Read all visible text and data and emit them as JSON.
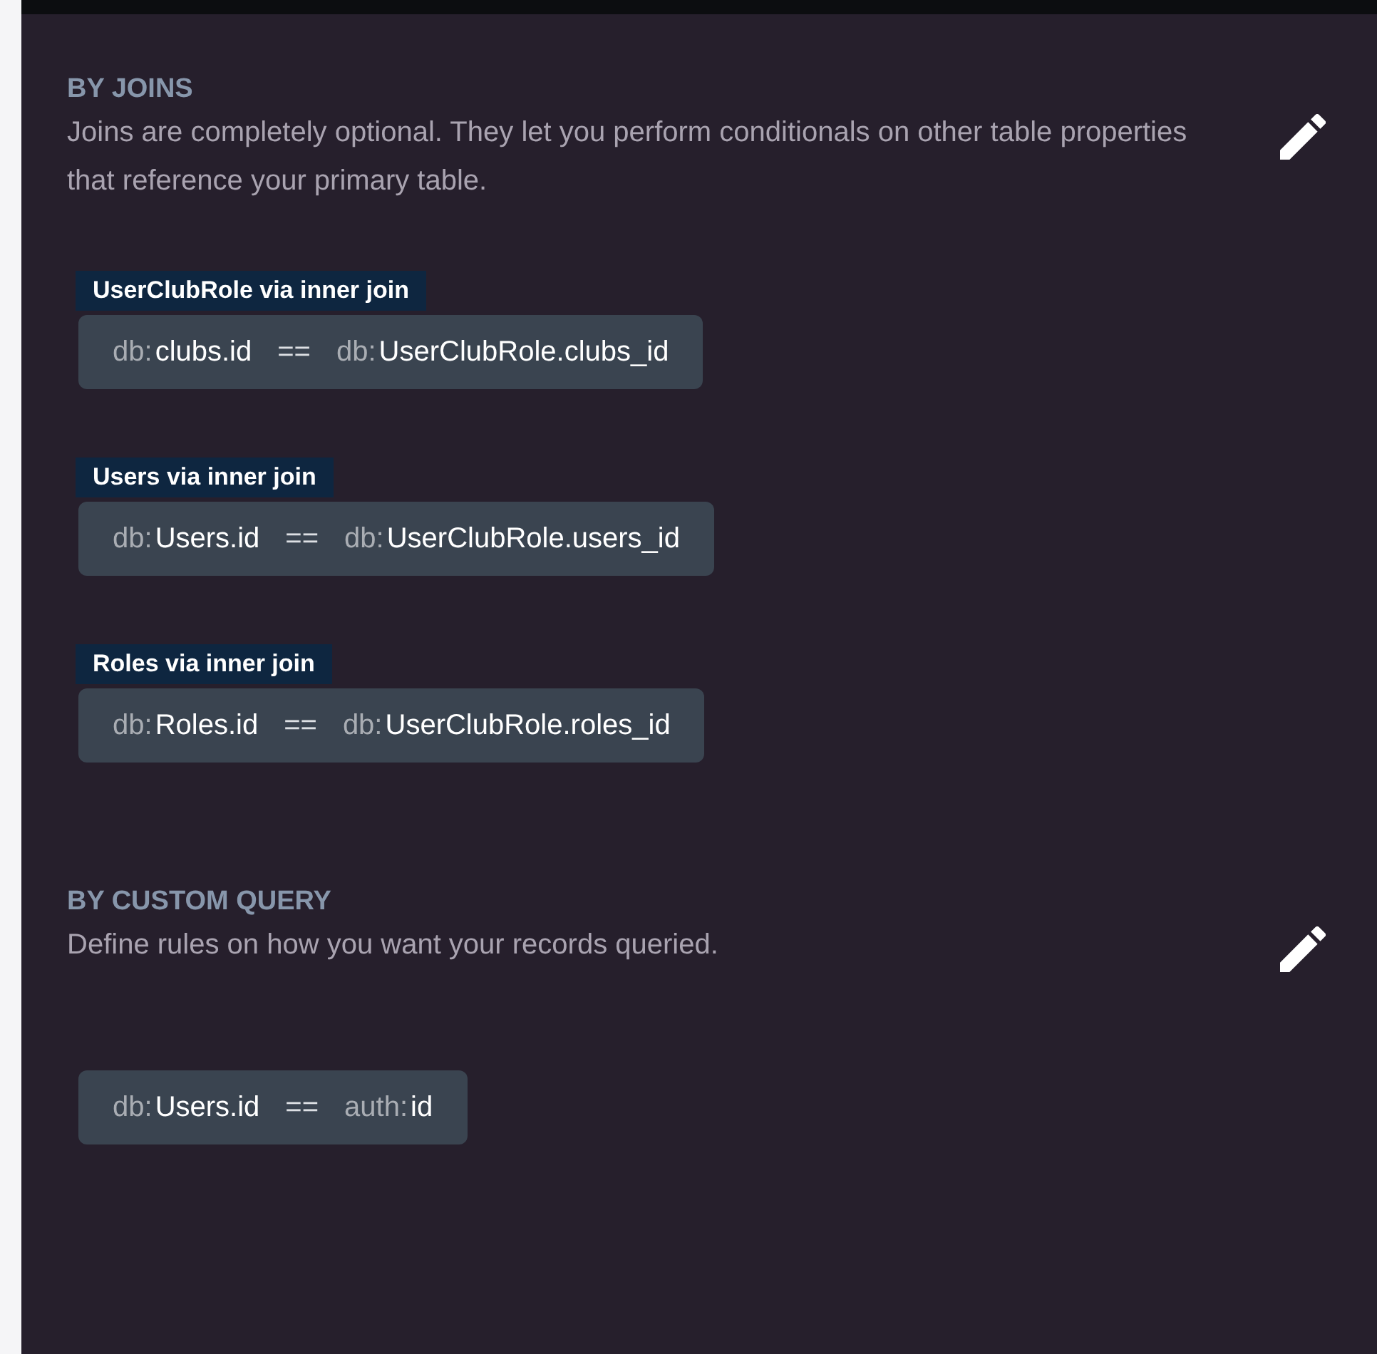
{
  "sections": [
    {
      "heading": "BY JOINS",
      "description": "Joins are completely optional. They let you perform conditionals on other table properties that reference your primary table.",
      "rules": [
        {
          "label": "UserClubRole via inner join",
          "left": {
            "prefix": "db:",
            "value": "clubs.id"
          },
          "operator": "==",
          "right": {
            "prefix": "db:",
            "value": "UserClubRole.clubs_id"
          }
        },
        {
          "label": "Users via inner join",
          "left": {
            "prefix": "db:",
            "value": "Users.id"
          },
          "operator": "==",
          "right": {
            "prefix": "db:",
            "value": "UserClubRole.users_id"
          }
        },
        {
          "label": "Roles via inner join",
          "left": {
            "prefix": "db:",
            "value": "Roles.id"
          },
          "operator": "==",
          "right": {
            "prefix": "db:",
            "value": "UserClubRole.roles_id"
          }
        }
      ]
    },
    {
      "heading": "BY CUSTOM QUERY",
      "description": "Define rules on how you want your records queried.",
      "rules": [
        {
          "left": {
            "prefix": "db:",
            "value": "Users.id"
          },
          "operator": "==",
          "right": {
            "prefix": "auth:",
            "value": "id"
          }
        }
      ]
    }
  ]
}
